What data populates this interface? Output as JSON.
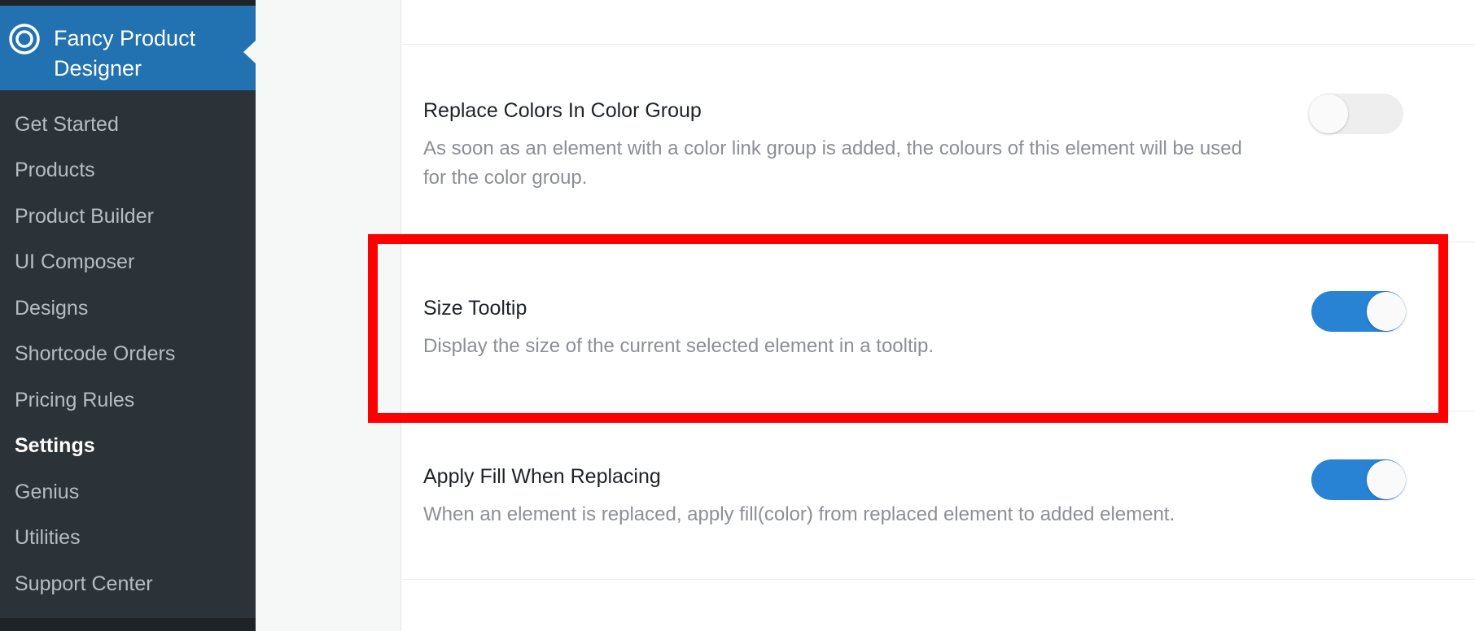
{
  "sidebar": {
    "title": "Fancy Product Designer",
    "logo_icon": "fpd-logo-icon",
    "items": [
      {
        "label": "Get Started",
        "active": false
      },
      {
        "label": "Products",
        "active": false
      },
      {
        "label": "Product Builder",
        "active": false
      },
      {
        "label": "UI Composer",
        "active": false
      },
      {
        "label": "Designs",
        "active": false
      },
      {
        "label": "Shortcode Orders",
        "active": false
      },
      {
        "label": "Pricing Rules",
        "active": false
      },
      {
        "label": "Settings",
        "active": true
      },
      {
        "label": "Genius",
        "active": false
      },
      {
        "label": "Utilities",
        "active": false
      },
      {
        "label": "Support Center",
        "active": false
      }
    ]
  },
  "settings": [
    {
      "title": "Replace Colors In Color Group",
      "description": "As soon as an element with a color link group is added, the colours of this element will be used for the color group.",
      "enabled": false
    },
    {
      "title": "Size Tooltip",
      "description": "Display the size of the current selected element in a tooltip.",
      "enabled": true,
      "highlighted": true
    },
    {
      "title": "Apply Fill When Replacing",
      "description": "When an element is replaced, apply fill(color) from replaced element to added element.",
      "enabled": true
    }
  ],
  "colors": {
    "sidebar_bg": "#2c3338",
    "sidebar_active_bg": "#2271b1",
    "toggle_on": "#2883d4",
    "toggle_off": "#eeeeee",
    "highlight": "#ff0000"
  }
}
